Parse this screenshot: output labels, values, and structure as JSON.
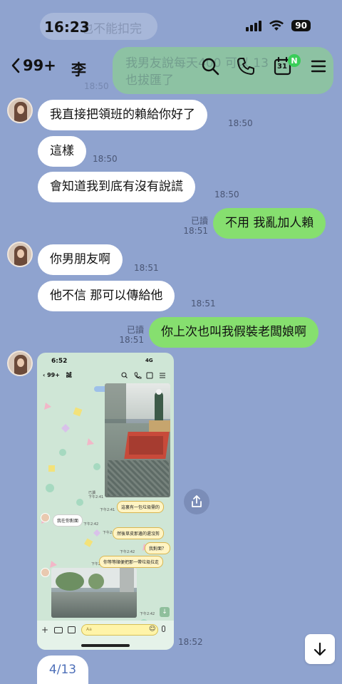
{
  "status": {
    "time": "16:23",
    "battery": "90"
  },
  "header": {
    "back_count": "99+",
    "contact_name": "李",
    "calendar_day": "31",
    "calendar_badge": "N"
  },
  "ghost": {
    "top_text": "也不能扣完",
    "bubble_line1": "我男友說每天400 可以 13",
    "bubble_line2": "也拔匯了",
    "time": "18:50"
  },
  "messages": [
    {
      "dir": "in",
      "avatar": true,
      "text": "我直接把領班的賴給你好了",
      "time": "18:50"
    },
    {
      "dir": "in",
      "text": "這樣",
      "time": "18:50"
    },
    {
      "dir": "in",
      "text": "會知道我到底有沒有說謊",
      "time": "18:50"
    },
    {
      "dir": "out",
      "read": "已讀",
      "text": "不用 我亂加人賴",
      "time": "18:51"
    },
    {
      "dir": "in",
      "avatar": true,
      "text": "你男朋友啊",
      "time": "18:51"
    },
    {
      "dir": "in",
      "text": "他不信 那可以傳給他",
      "time": "18:51"
    },
    {
      "dir": "out",
      "read": "已讀",
      "text": "你上次也叫我假裝老闆娘啊",
      "time": "18:51"
    }
  ],
  "image_message": {
    "time": "18:52",
    "inner": {
      "time": "6:52",
      "network": "4G",
      "back_count": "99+",
      "name": "誠",
      "read": "已讀",
      "t1": "下午2:41",
      "t2": "下午2:42",
      "b1": "這裏有一包垃圾需的",
      "b2": "我在你對面",
      "b3": "然後草皮那邊的還沒剪",
      "b4": "我對面？",
      "b5": "你等等順便把那一帶垃圾拉走",
      "input_placeholder": "Aa"
    }
  },
  "date_pill": "4/13",
  "colors": {
    "background": "#8fa3cf",
    "outgoing": "#86df6f",
    "incoming": "#ffffff",
    "badge": "#39cd58",
    "date_text": "#4d6fb8"
  }
}
